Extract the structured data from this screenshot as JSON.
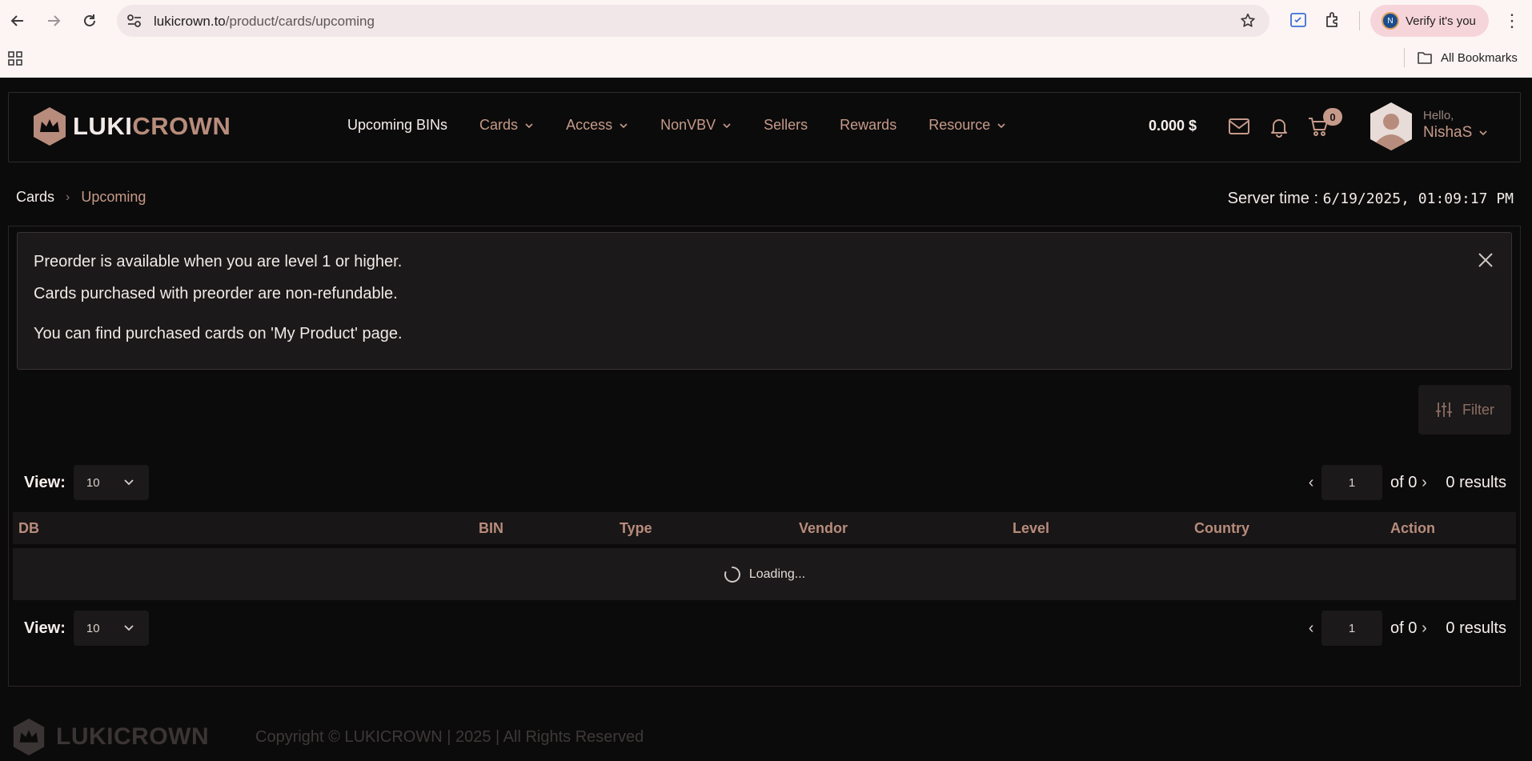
{
  "browser": {
    "url_domain": "lukicrown.to",
    "url_path": "/product/cards/upcoming",
    "profile_initial": "N",
    "verify_label": "Verify it's you",
    "bookmarks_label": "All Bookmarks"
  },
  "site": {
    "logo_part1": "LUKI",
    "logo_part2": "CROWN",
    "nav": [
      {
        "label": "Upcoming BINs",
        "active": true,
        "dropdown": false
      },
      {
        "label": "Cards",
        "dropdown": true
      },
      {
        "label": "Access",
        "dropdown": true
      },
      {
        "label": "NonVBV",
        "dropdown": true
      },
      {
        "label": "Sellers",
        "dropdown": false
      },
      {
        "label": "Rewards",
        "dropdown": false
      },
      {
        "label": "Resource",
        "dropdown": true
      }
    ],
    "balance": "0.000 $",
    "cart_count": "0",
    "greeting": "Hello,",
    "username": "NishaS"
  },
  "breadcrumb": {
    "root": "Cards",
    "current": "Upcoming"
  },
  "server_time": {
    "label": "Server time :",
    "value": "6/19/2025, 01:09:17 PM"
  },
  "alert": {
    "line1": "Preorder is available when you are level 1 or higher.",
    "line2": "Cards purchased with preorder are non-refundable.",
    "line3": "You can find purchased cards on 'My Product' page."
  },
  "filter_label": "Filter",
  "pagination": {
    "view_label": "View:",
    "view_value": "10",
    "page_value": "1",
    "of_label": "of 0",
    "results_label": "0 results"
  },
  "table": {
    "columns": [
      "DB",
      "BIN",
      "Type",
      "Vendor",
      "Level",
      "Country",
      "Action"
    ],
    "loading_text": "Loading..."
  },
  "footer": {
    "logo_text": "LUKICROWN",
    "copyright": "Copyright © LUKICROWN | 2025 | All Rights Reserved"
  },
  "colors": {
    "accent": "#c69a8a",
    "background": "#0c0b0b",
    "panel": "#1b1919"
  }
}
